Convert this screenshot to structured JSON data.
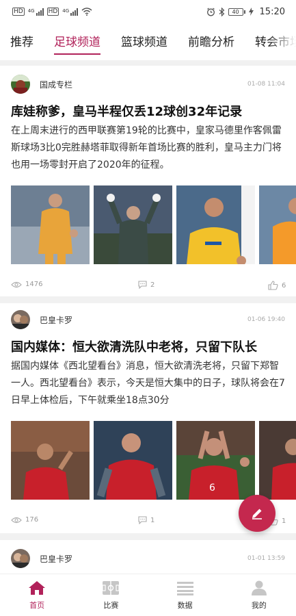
{
  "status_bar": {
    "sim1_label": "HD",
    "sim2_label": "HD",
    "network1": "4G",
    "network2": "4G",
    "battery": "40",
    "time": "15:20"
  },
  "tabs": [
    {
      "label": "推荐",
      "active": false
    },
    {
      "label": "足球频道",
      "active": true
    },
    {
      "label": "篮球频道",
      "active": false
    },
    {
      "label": "前瞻分析",
      "active": false
    },
    {
      "label": "转会市场",
      "active": false
    }
  ],
  "articles": [
    {
      "author": "国成专栏",
      "time": "01-08 11:04",
      "title": "库娃称爹，皇马半程仅丢12球创32年记录",
      "summary": "在上周末进行的西甲联赛第19轮的比赛中，皇家马德里作客佩雷斯球场3比0完胜赫塔菲取得新年首场比赛的胜利，皇马主力门将也用一场零封开启了2020年的征程。",
      "views": "1476",
      "comments": "2",
      "likes": "6"
    },
    {
      "author": "巴皇卡罗",
      "time": "01-06 19:40",
      "title": "国内媒体：恒大欲清洗队中老将，只留下队长",
      "summary": "据国内媒体《西北望看台》消息，恒大欲清洗老将，只留下郑智一人。西北望看台》表示，今天是恒大集中的日子，球队将会在7日早上体检后，下午就乘坐18点30分",
      "views": "176",
      "comments": "1",
      "likes": "1"
    },
    {
      "author": "巴皇卡罗",
      "time": "01-01 13:59"
    }
  ],
  "bottom_nav": [
    {
      "label": "首页",
      "icon": "home-icon",
      "active": true
    },
    {
      "label": "比赛",
      "icon": "match-icon",
      "active": false
    },
    {
      "label": "数据",
      "icon": "data-icon",
      "active": false
    },
    {
      "label": "我的",
      "icon": "profile-icon",
      "active": false
    }
  ],
  "colors": {
    "accent": "#b1225a",
    "fab": "#c4284e"
  }
}
